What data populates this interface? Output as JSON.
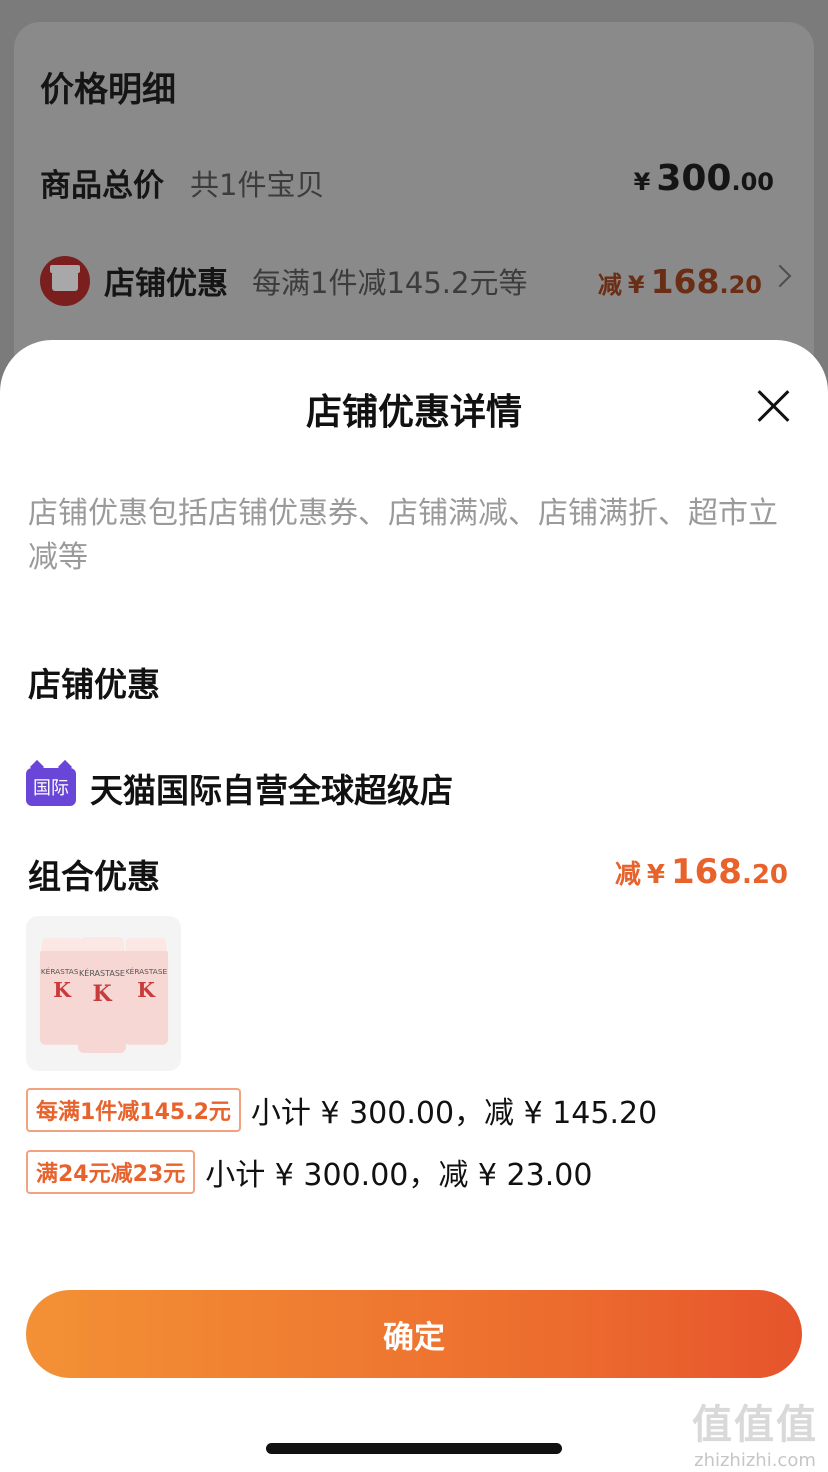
{
  "background": {
    "title": "价格明细",
    "goods_total": {
      "label": "商品总价",
      "sub": "共1件宝贝",
      "currency": "¥",
      "int": "300",
      "dec": ".00"
    },
    "shop_discount": {
      "label": "店铺优惠",
      "sub": "每满1件减145.2元等",
      "prefix": "减",
      "currency": "¥",
      "int": "168",
      "dec": ".20"
    }
  },
  "sheet": {
    "title": "店铺优惠详情",
    "description": "店铺优惠包括店铺优惠券、店铺满减、店铺满折、超市立减等",
    "section_title": "店铺优惠",
    "store": {
      "badge": "国际",
      "name": "天猫国际自营全球超级店"
    },
    "combo": {
      "title": "组合优惠",
      "prefix": "减",
      "currency": "¥",
      "int": "168",
      "dec": ".20"
    },
    "product_brand": "KÉRASTASE",
    "promos": [
      {
        "tag": "每满1件减145.2元",
        "text": "小计 ¥ 300.00，减 ¥ 145.20"
      },
      {
        "tag": "满24元减23元",
        "text": "小计 ¥ 300.00，减 ¥ 23.00"
      }
    ],
    "confirm": "确定"
  },
  "watermark": {
    "glyphs": "值值值",
    "url": "zhizhizhi.com"
  },
  "icons": {
    "shop": "shop-icon",
    "tmall": "tmall-global-icon",
    "close": "close-icon",
    "chevron": "chevron-right-icon"
  },
  "colors": {
    "accent": "#e8622c",
    "button_start": "#f39135",
    "button_end": "#e6542c",
    "tmall_purple": "#6a46d8"
  }
}
